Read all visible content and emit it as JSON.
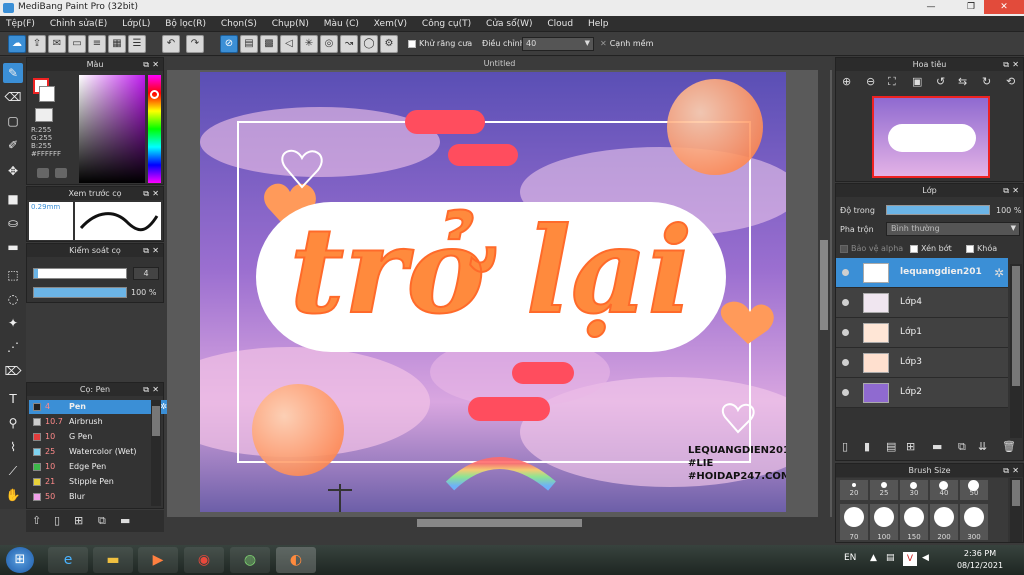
{
  "window": {
    "title": "MediBang Paint Pro (32bit)"
  },
  "menu": [
    "Tệp(F)",
    "Chỉnh sửa(E)",
    "Lớp(L)",
    "Bộ lọc(R)",
    "Chọn(S)",
    "Chụp(N)",
    "Màu (C)",
    "Xem(V)",
    "Công cụ(T)",
    "Cửa sổ(W)",
    "Cloud",
    "Help"
  ],
  "toolbar": {
    "antialias_label": "Khử răng cưa",
    "adjust_label": "Điều chỉnh",
    "adjust_value": "40",
    "sharp_label": "Cạnh mềm"
  },
  "color_panel": {
    "title": "Màu",
    "r": "R:255",
    "g": "G:255",
    "b": "B:255",
    "hex": "#FFFFFF"
  },
  "preview_panel": {
    "title": "Xem trước cọ",
    "size": "0.29mm"
  },
  "control_panel": {
    "title": "Kiểm soát cọ",
    "size_value": "4",
    "opacity_value": "100 %"
  },
  "brush_panel": {
    "title": "Cọ: Pen",
    "brushes": [
      {
        "size": "4",
        "name": "Pen",
        "color": "#222222"
      },
      {
        "size": "10.7",
        "name": "Airbrush",
        "color": "#cccccc"
      },
      {
        "size": "10",
        "name": "G Pen",
        "color": "#e23c3c"
      },
      {
        "size": "25",
        "name": "Watercolor (Wet)",
        "color": "#7fd3f0"
      },
      {
        "size": "10",
        "name": "Edge Pen",
        "color": "#3cb84a"
      },
      {
        "size": "21",
        "name": "Stipple Pen",
        "color": "#e8d23a"
      },
      {
        "size": "50",
        "name": "Blur",
        "color": "#f0a0e8"
      }
    ]
  },
  "canvas": {
    "tab_title": "Untitled",
    "art_text": "trở lại",
    "watermark": [
      "LEQUANGDIEN201",
      "#LIE",
      "#HOIDAP247.COM"
    ]
  },
  "navigator": {
    "title": "Hoa tiêu"
  },
  "layer_panel": {
    "title": "Lớp",
    "opacity_label": "Độ trong",
    "opacity_value": "100 %",
    "blend_label": "Pha trộn",
    "blend_value": "Bình thường",
    "protect_alpha": "Bảo vệ alpha",
    "clip_label": "Xén bớt",
    "lock_label": "Khóa",
    "layers": [
      {
        "name": "lequangdien201"
      },
      {
        "name": "Lớp4"
      },
      {
        "name": "Lớp1"
      },
      {
        "name": "Lớp3"
      },
      {
        "name": "Lớp2"
      }
    ]
  },
  "brush_size_panel": {
    "title": "Brush Size",
    "row1": [
      "20",
      "25",
      "30",
      "40",
      "50"
    ],
    "row2": [
      "70",
      "100",
      "150",
      "200",
      "300"
    ]
  },
  "taskbar": {
    "lang": "EN",
    "time": "2:36 PM",
    "date": "08/12/2021"
  }
}
